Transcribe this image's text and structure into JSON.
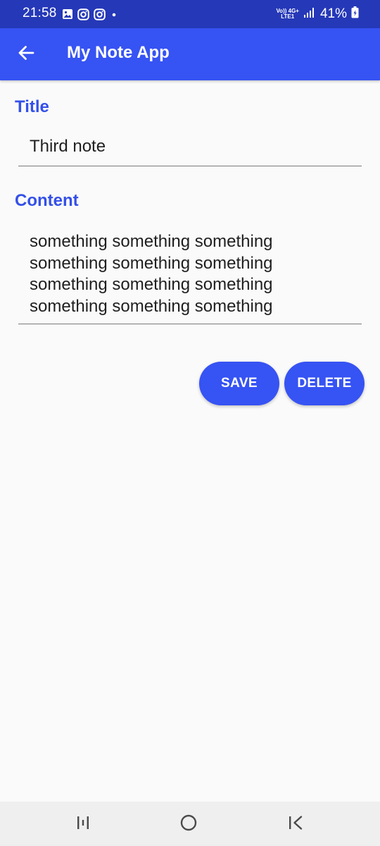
{
  "status_bar": {
    "time": "21:58",
    "left_icons": [
      "gallery-icon",
      "instagram-icon",
      "instagram-icon",
      "dot-icon"
    ],
    "network_top": "Vo)) 4G+",
    "network_bottom": "LTE1",
    "battery": "41%",
    "background": "#2538b8"
  },
  "app_bar": {
    "title": "My Note App",
    "back_icon": "arrow-back-icon",
    "background": "#3653f3"
  },
  "form": {
    "title_label": "Title",
    "title_value": "Third note",
    "content_label": "Content",
    "content_lines": [
      "something something something",
      "something something something",
      "something something something",
      "something something something"
    ],
    "label_color": "#3450e8"
  },
  "actions": {
    "save_label": "SAVE",
    "delete_label": "DELETE",
    "button_color": "#3653f3"
  },
  "nav_bar": {
    "recents_icon": "recents-icon",
    "home_icon": "home-icon",
    "back_icon": "back-icon"
  }
}
